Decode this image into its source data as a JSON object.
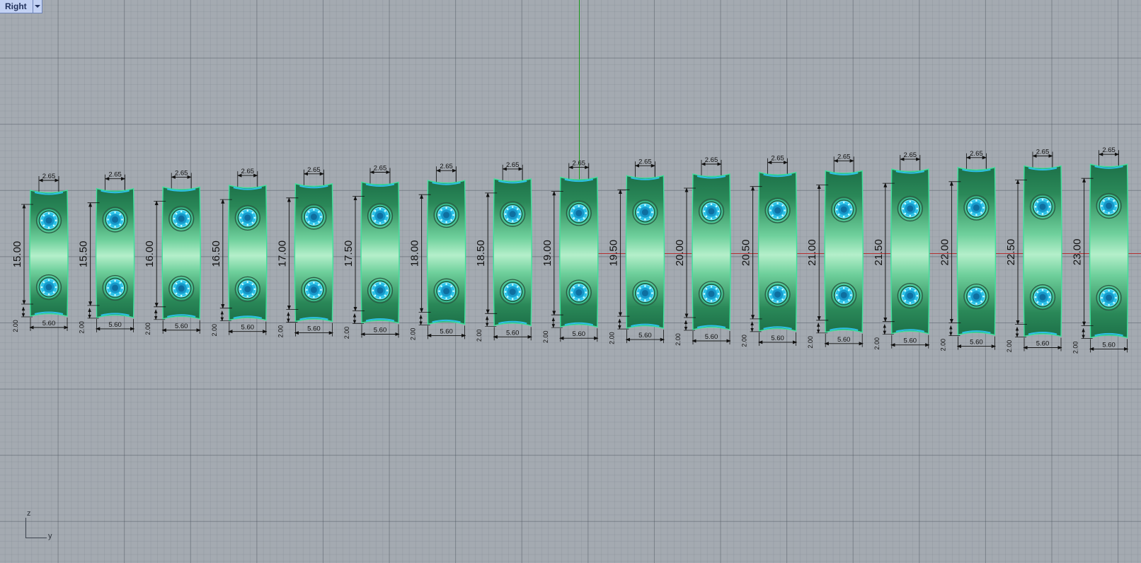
{
  "viewport": {
    "name": "Right",
    "axis_labels": {
      "vertical": "z",
      "horizontal": "y"
    }
  },
  "colors": {
    "band_dark": "#1d7149",
    "band_light": "#b4efca",
    "band_edge": "#3ee09c",
    "gem": "#2cc2e8",
    "red_axis": "#b43030",
    "green_axis": "#1a9a1a"
  },
  "rings": [
    {
      "size": "15.00",
      "top_width": "2.65",
      "bottom_width": "5.60",
      "edge": "2.00"
    },
    {
      "size": "15.50",
      "top_width": "2.65",
      "bottom_width": "5.60",
      "edge": "2.00"
    },
    {
      "size": "16.00",
      "top_width": "2.65",
      "bottom_width": "5.60",
      "edge": "2.00"
    },
    {
      "size": "16.50",
      "top_width": "2.65",
      "bottom_width": "5.60",
      "edge": "2.00"
    },
    {
      "size": "17.00",
      "top_width": "2.65",
      "bottom_width": "5.60",
      "edge": "2.00"
    },
    {
      "size": "17.50",
      "top_width": "2.65",
      "bottom_width": "5.60",
      "edge": "2.00"
    },
    {
      "size": "18.00",
      "top_width": "2.65",
      "bottom_width": "5.60",
      "edge": "2.00"
    },
    {
      "size": "18.50",
      "top_width": "2.65",
      "bottom_width": "5.60",
      "edge": "2.00"
    },
    {
      "size": "19.00",
      "top_width": "2.65",
      "bottom_width": "5.60",
      "edge": "2.00"
    },
    {
      "size": "19.50",
      "top_width": "2.65",
      "bottom_width": "5.60",
      "edge": "2.00"
    },
    {
      "size": "20.00",
      "top_width": "2.65",
      "bottom_width": "5.60",
      "edge": "2.00"
    },
    {
      "size": "20.50",
      "top_width": "2.65",
      "bottom_width": "5.60",
      "edge": "2.00"
    },
    {
      "size": "21.00",
      "top_width": "2.65",
      "bottom_width": "5.60",
      "edge": "2.00"
    },
    {
      "size": "21.50",
      "top_width": "2.65",
      "bottom_width": "5.60",
      "edge": "2.00"
    },
    {
      "size": "22.00",
      "top_width": "2.65",
      "bottom_width": "5.60",
      "edge": "2.00"
    },
    {
      "size": "22.50",
      "top_width": "2.65",
      "bottom_width": "5.60",
      "edge": "2.00"
    },
    {
      "size": "23.00",
      "top_width": "2.65",
      "bottom_width": "5.60",
      "edge": "2.00"
    }
  ]
}
